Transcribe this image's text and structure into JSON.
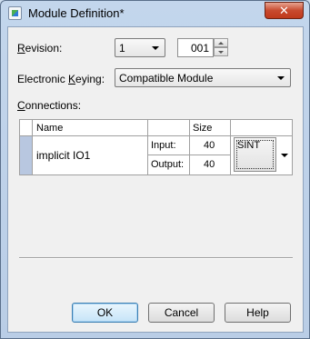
{
  "window": {
    "title": "Module Definition*",
    "close_glyph": "✕"
  },
  "revision": {
    "label_prefix": "R",
    "label_rest": "evision:",
    "major": "1",
    "minor": "001"
  },
  "keying": {
    "label_pre": "Electronic ",
    "label_u": "K",
    "label_post": "eying:",
    "value": "Compatible Module"
  },
  "connections": {
    "label_u": "C",
    "label_rest": "onnections:",
    "headers": {
      "name": "Name",
      "size": "Size"
    },
    "row": {
      "name": "implicit IO1",
      "input_label": "Input:",
      "input_value": "40",
      "output_label": "Output:",
      "output_value": "40",
      "data_type": "SINT"
    }
  },
  "buttons": {
    "ok": "OK",
    "cancel": "Cancel",
    "help": "Help"
  }
}
